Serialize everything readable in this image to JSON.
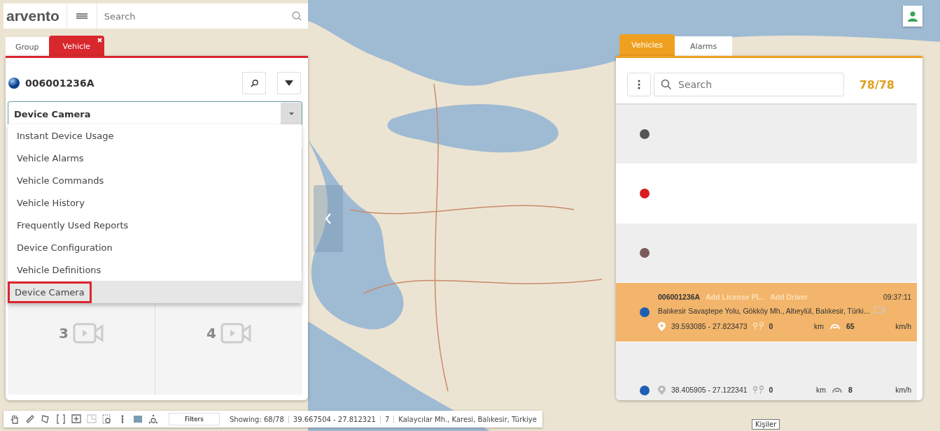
{
  "top_bar": {
    "logo": "arvento",
    "search_placeholder": "Search"
  },
  "left_tabs": [
    {
      "label": "Group",
      "selected": false,
      "closable": false
    },
    {
      "label": "Vehicle",
      "selected": true,
      "closable": true
    }
  ],
  "vehicle_panel": {
    "vehicle": "006001236A",
    "menu": {
      "value": "Device Camera",
      "expanded": true,
      "options": [
        {
          "label": "Instant Device Usage",
          "selected": false
        },
        {
          "label": "Vehicle Alarms",
          "selected": false
        },
        {
          "label": "Vehicle Commands",
          "selected": false
        },
        {
          "label": "Vehicle History",
          "selected": false
        },
        {
          "label": "Frequently Used Reports",
          "selected": false
        },
        {
          "label": "Device Configuration",
          "selected": false
        },
        {
          "label": "Vehicle Definitions",
          "selected": false
        },
        {
          "label": "Device Camera",
          "selected": true
        }
      ]
    },
    "camera_slots": [
      {
        "number": "3"
      },
      {
        "number": "4"
      }
    ]
  },
  "vehicle_list": {
    "tabs": [
      {
        "label": "Vehicles",
        "selected": true
      },
      {
        "label": "Alarms",
        "selected": false
      }
    ],
    "search_placeholder": "Search",
    "count": "78/78",
    "rows": [
      {
        "kind": "marker",
        "color": "#555555",
        "selected": false
      },
      {
        "kind": "marker",
        "color": "#d81e1e",
        "selected": false
      },
      {
        "kind": "marker",
        "color": "#7a5a5a",
        "selected": false
      },
      {
        "kind": "detail",
        "color": "#1e5fb4",
        "selected": true,
        "id": "006001236A",
        "plate_action": "Add License Pl...",
        "driver_action": "Add Driver",
        "time": "09:37:11",
        "address": "Balıkesir Savaştepe Yolu, Gökköy Mh., Altıeylül, Balıkesir, Türki...",
        "coordinates": "39.593085 - 27.823473",
        "distance": "0",
        "distance_unit": "km",
        "speed": "65",
        "speed_unit": "km/h"
      },
      {
        "kind": "partial",
        "color": "#1e5fb4",
        "selected": false,
        "coordinates": "38.405905 - 27.122341",
        "distance": "0",
        "distance_unit": "km",
        "speed": "8",
        "speed_unit": "km/h"
      }
    ]
  },
  "toolbar": {
    "filters": "Filters",
    "showing": "Showing: 68/78",
    "coordinates": "39.667504 - 27.812321",
    "zoom": "7",
    "address": "Kalaycılar Mh., Karesi, Balıkesir, Türkiye"
  },
  "tooltip": "Kişiler"
}
